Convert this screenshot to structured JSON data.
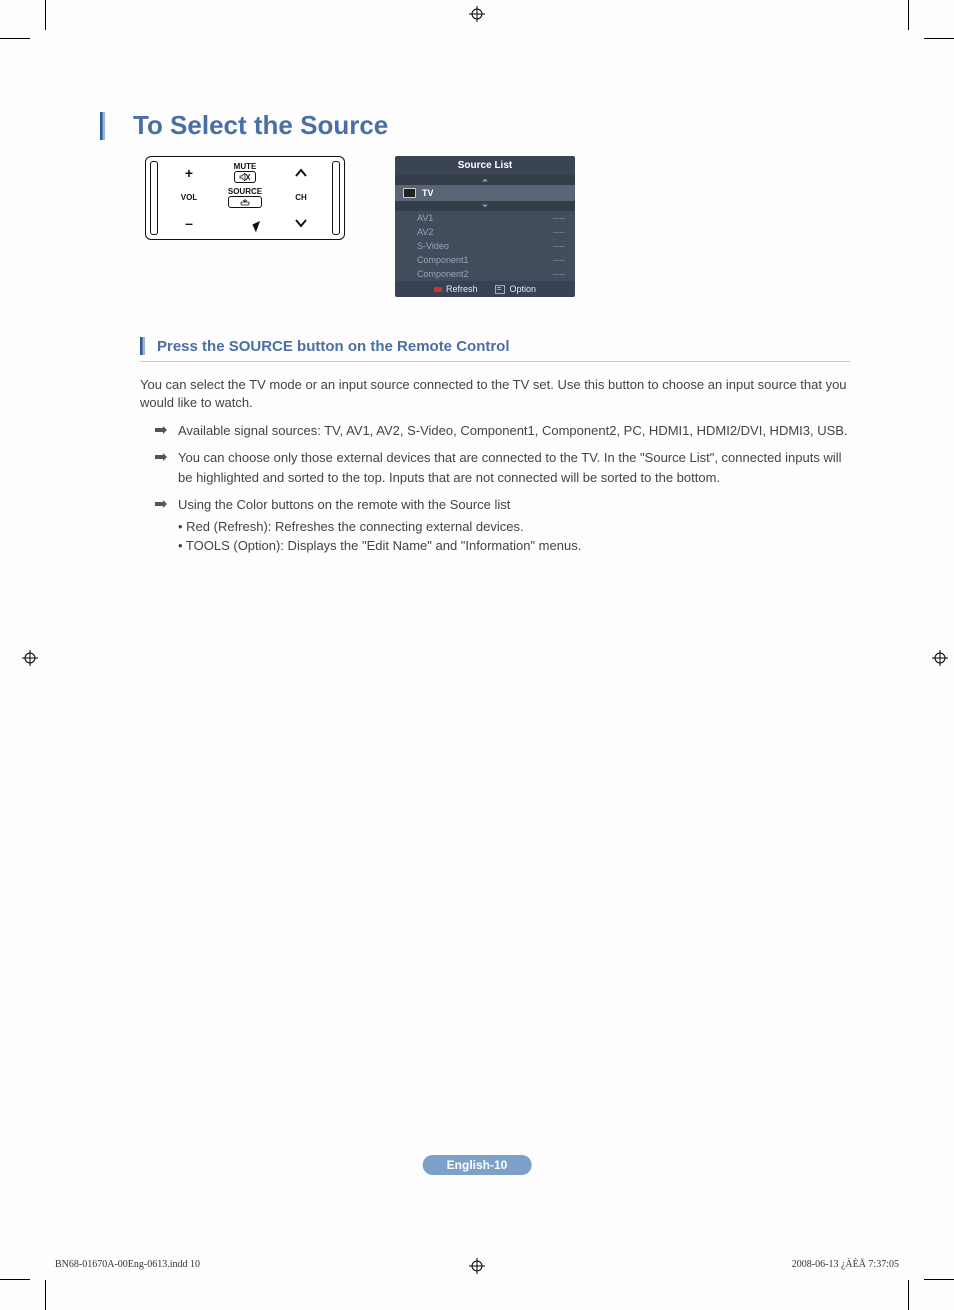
{
  "section_title": "To Select the Source",
  "remote": {
    "mute": "MUTE",
    "vol": "VOL",
    "ch": "CH",
    "source": "SOURCE"
  },
  "osd": {
    "title": "Source List",
    "selected": "TV",
    "items": [
      {
        "name": "AV1",
        "status": "----"
      },
      {
        "name": "AV2",
        "status": "----"
      },
      {
        "name": "S-Video",
        "status": "----"
      },
      {
        "name": "Component1",
        "status": "----"
      },
      {
        "name": "Component2",
        "status": "----"
      }
    ],
    "footer": {
      "refresh": "Refresh",
      "option": "Option"
    }
  },
  "sub_heading": "Press the SOURCE button on the Remote Control",
  "intro": "You can select the TV mode or an input source connected to the TV set. Use this button to choose an input source that you would like to watch.",
  "bullets": [
    {
      "text": "Available signal sources: TV, AV1, AV2, S-Video, Component1, Component2, PC, HDMI1, HDMI2/DVI, HDMI3, USB."
    },
    {
      "text": "You can choose only those external devices that are connected to the TV. In the \"Source List\", connected inputs will be highlighted and sorted to the top. Inputs that are not connected will be sorted to the bottom."
    },
    {
      "text": "Using the Color buttons on the remote with the Source list",
      "sub": [
        "• Red (Refresh): Refreshes the connecting external devices.",
        "• TOOLS (Option): Displays the \"Edit Name\" and \"Information\" menus."
      ]
    }
  ],
  "page_badge": "English-10",
  "footer": {
    "left": "BN68-01670A-00Eng-0613.indd   10",
    "right": "2008-06-13   ¿ÀÈÄ 7:37:05"
  }
}
